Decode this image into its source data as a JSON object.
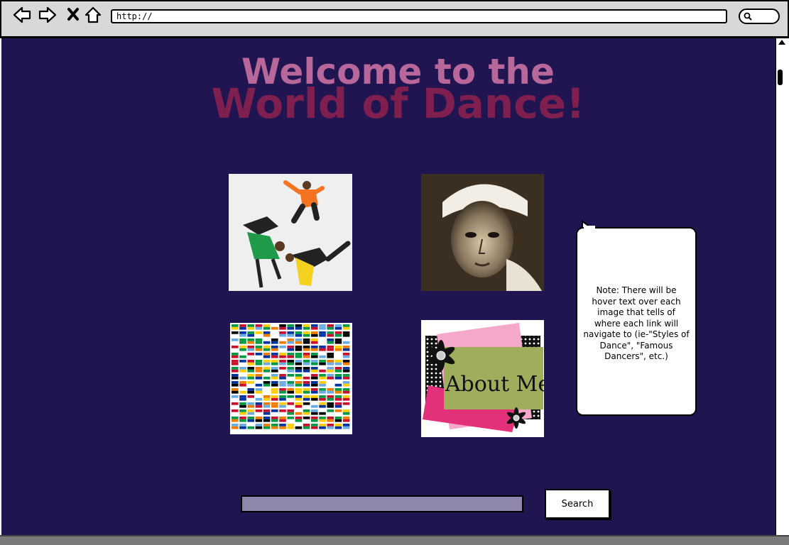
{
  "browser": {
    "url": "http://",
    "icons": [
      "back-arrow-icon",
      "forward-arrow-icon",
      "close-x-icon",
      "home-icon",
      "search-icon"
    ]
  },
  "page": {
    "title_line1": "Welcome to the",
    "title_line2": "World of Dance!",
    "background_color": "#211551",
    "title_color_1": "#b8679a",
    "title_color_2": "#7e1f4f",
    "tiles": [
      {
        "name": "dancers-photo",
        "link_hint": "Styles of Dance"
      },
      {
        "name": "famous-dancer-portrait",
        "link_hint": "Famous Dancers"
      },
      {
        "name": "world-flags-grid",
        "link_hint": ""
      },
      {
        "name": "about-me-graphic",
        "text": "About Me"
      }
    ],
    "note": "Note: There will be hover text over each image that tells of where each link will navigate to (ie-\"Styles of Dance\", \"Famous Dancers\", etc.)",
    "search": {
      "value": "",
      "button_label": "Search"
    }
  }
}
